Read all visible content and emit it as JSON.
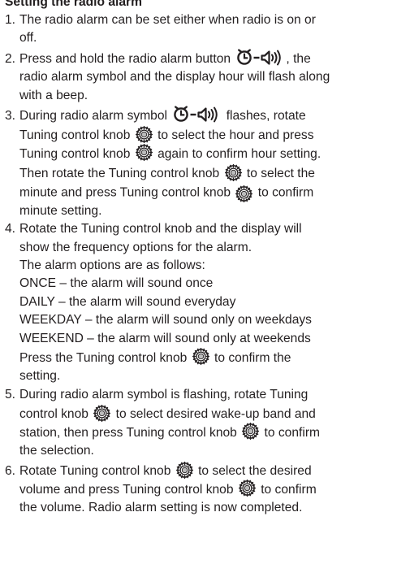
{
  "section": {
    "heading": "Setting the radio alarm"
  },
  "icons": {
    "alarm_symbol": "radio-alarm-icon",
    "knob": "tuning-knob-icon"
  },
  "steps": [
    {
      "number": "1.",
      "lines": [
        "The radio alarm can be set either when radio is on or",
        "off."
      ]
    },
    {
      "number": "2.",
      "l1_pre": "Press and hold the radio alarm button",
      "l1_post": ", the",
      "l2": "radio alarm symbol and the display hour will flash along",
      "l3": "with a beep."
    },
    {
      "number": "3.",
      "l1_pre": "During radio alarm symbol",
      "l1_post": "flashes, rotate",
      "l2_pre": "Tuning control knob",
      "l2_post": "to select the hour and press",
      "l3_pre": "Tuning control knob",
      "l3_post": "again to confirm hour setting.",
      "l4_pre": "Then rotate the Tuning control knob",
      "l4_post": "to select the",
      "l5_pre": "minute and press Tuning control knob",
      "l5_post": "to confirm",
      "l6": "minute setting."
    },
    {
      "number": "4.",
      "l1": "Rotate the Tuning control knob and the display will",
      "l2": "show the frequency options for the alarm.",
      "l3": "The alarm options are as follows:",
      "options": [
        "ONCE – the alarm will sound once",
        "DAILY – the alarm will sound everyday",
        "WEEKDAY – the alarm will sound only on weekdays",
        "WEEKEND – the alarm will sound only at weekends"
      ],
      "l8_pre": "Press the Tuning control knob",
      "l8_post": "to confirm the",
      "l9": "setting."
    },
    {
      "number": "5.",
      "l1": "During radio alarm symbol is flashing, rotate Tuning",
      "l2_pre": "control knob",
      "l2_post": "to select desired wake-up band and",
      "l3_pre": "station, then press Tuning control knob",
      "l3_post": "to confirm",
      "l4": "the selection."
    },
    {
      "number": "6.",
      "l1_pre": "Rotate Tuning control knob",
      "l1_post": "to select the desired",
      "l2_pre": "volume and press Tuning control knob",
      "l2_post": "to confirm",
      "l3": "the volume. Radio alarm setting is now completed."
    }
  ]
}
